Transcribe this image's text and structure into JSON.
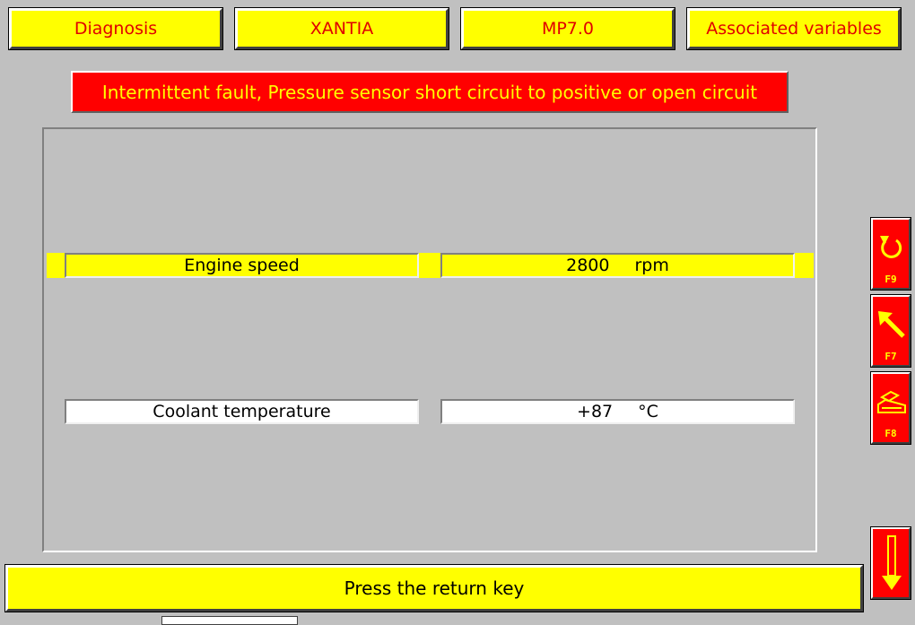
{
  "header": {
    "tabs": [
      {
        "label": "Diagnosis"
      },
      {
        "label": "XANTIA"
      },
      {
        "label": "MP7.0"
      },
      {
        "label": "Associated variables"
      }
    ]
  },
  "fault": {
    "message": "Intermittent fault, Pressure sensor short circuit to positive or open circuit"
  },
  "variables": [
    {
      "name": "Engine speed",
      "value": "2800",
      "unit": "rpm",
      "selected": true
    },
    {
      "name": "Coolant temperature",
      "value": "+87",
      "unit": "°C",
      "selected": false
    }
  ],
  "function_keys": [
    {
      "key": "F9",
      "icon": "undo-icon"
    },
    {
      "key": "F7",
      "icon": "arrow-up-left-icon"
    },
    {
      "key": "F8",
      "icon": "printer-icon"
    }
  ],
  "return_key": {
    "icon": "arrow-down-icon"
  },
  "status": {
    "message": "Press the return key"
  },
  "colors": {
    "background": "#c0c0c0",
    "yellow": "#ffff00",
    "red": "#ff0000",
    "tab_text": "#e00000"
  }
}
